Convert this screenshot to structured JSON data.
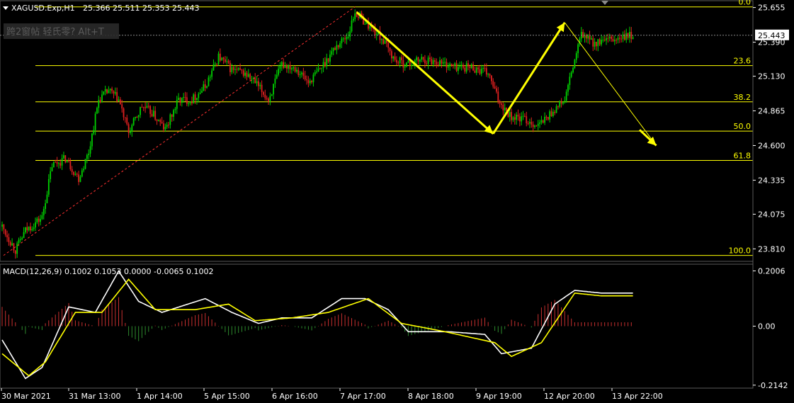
{
  "header": {
    "symbol": "XAGUSD.Exp,H1",
    "ohlc": "25.366 25.511 25.353 25.443"
  },
  "overlay_hint": "跨2窗帖 轻氏零? Alt+T",
  "macd_header": "MACD(12,26,9) 0.1002 0.1053 0.0000 -0.0065 0.1002",
  "colors": {
    "background": "#000000",
    "bull": "#00d000",
    "bear": "#e02020",
    "fib": "#ffff00",
    "arrow": "#ffff00",
    "trend": "#ff3030",
    "macd_line": "#ffffff",
    "signal_line": "#ffff00",
    "hist_pos": "#c83030",
    "hist_neg": "#2e8b2e",
    "axis": "#ffffff"
  },
  "chart_data": [
    {
      "type": "candlestick",
      "ylim": [
        23.72,
        25.68
      ],
      "y_ticks": [
        "25.655",
        "25.390",
        "25.130",
        "24.865",
        "24.600",
        "24.335",
        "24.075",
        "23.810"
      ],
      "y_tick_values": [
        25.655,
        25.39,
        25.13,
        24.865,
        24.6,
        24.335,
        24.075,
        23.81
      ],
      "current_price": "25.443",
      "current_price_value": 25.443,
      "x_labels": [
        "30 Mar 2021",
        "31 Mar 13:00",
        "1 Apr 14:00",
        "5 Apr 15:00",
        "6 Apr 16:00",
        "7 Apr 17:00",
        "8 Apr 18:00",
        "9 Apr 19:00",
        "12 Apr 20:00",
        "13 Apr 22:00"
      ],
      "fibonacci": {
        "low": 23.76,
        "high": 25.66,
        "levels": [
          {
            "label": "0.0",
            "value": 25.66
          },
          {
            "label": "23.6",
            "value": 25.211
          },
          {
            "label": "38.2",
            "value": 24.934
          },
          {
            "label": "50.0",
            "value": 24.71
          },
          {
            "label": "61.8",
            "value": 24.486
          },
          {
            "label": "100.0",
            "value": 23.76
          }
        ]
      },
      "waypoints": [
        [
          0,
          23.98
        ],
        [
          8,
          23.8
        ],
        [
          14,
          23.95
        ],
        [
          24,
          24.05
        ],
        [
          30,
          24.45
        ],
        [
          38,
          24.5
        ],
        [
          46,
          24.35
        ],
        [
          52,
          24.55
        ],
        [
          58,
          24.95
        ],
        [
          64,
          25.02
        ],
        [
          70,
          24.95
        ],
        [
          76,
          24.7
        ],
        [
          84,
          24.9
        ],
        [
          90,
          24.85
        ],
        [
          98,
          24.72
        ],
        [
          106,
          24.95
        ],
        [
          114,
          24.95
        ],
        [
          122,
          25.05
        ],
        [
          130,
          25.28
        ],
        [
          138,
          25.18
        ],
        [
          146,
          25.15
        ],
        [
          152,
          25.08
        ],
        [
          160,
          24.95
        ],
        [
          168,
          25.22
        ],
        [
          176,
          25.2
        ],
        [
          184,
          25.08
        ],
        [
          192,
          25.2
        ],
        [
          200,
          25.35
        ],
        [
          208,
          25.45
        ],
        [
          212,
          25.62
        ],
        [
          220,
          25.52
        ],
        [
          228,
          25.42
        ],
        [
          236,
          25.25
        ],
        [
          244,
          25.22
        ],
        [
          252,
          25.26
        ],
        [
          262,
          25.24
        ],
        [
          272,
          25.2
        ],
        [
          282,
          25.2
        ],
        [
          292,
          25.15
        ],
        [
          298,
          24.95
        ],
        [
          306,
          24.82
        ],
        [
          314,
          24.8
        ],
        [
          322,
          24.75
        ],
        [
          330,
          24.85
        ],
        [
          338,
          24.95
        ],
        [
          344,
          25.25
        ],
        [
          348,
          25.45
        ],
        [
          356,
          25.38
        ],
        [
          364,
          25.4
        ],
        [
          372,
          25.42
        ],
        [
          378,
          25.44
        ]
      ],
      "annotations": {
        "trend_line": [
          [
            23.76,
            0
          ],
          [
            25.66,
            212
          ]
        ],
        "arrow_1": [
          [
            25.62,
            213
          ],
          [
            24.69,
            295
          ]
        ],
        "arrow_2": [
          [
            24.69,
            295
          ],
          [
            25.54,
            338
          ]
        ],
        "arrow_3": [
          [
            25.54,
            338
          ],
          [
            24.6,
            393
          ]
        ]
      }
    },
    {
      "type": "macd",
      "params": "12,26,9",
      "ylim": [
        -0.225,
        0.225
      ],
      "y_ticks": [
        "0.2006",
        "0.00",
        "-0.2142"
      ],
      "y_tick_values": [
        0.2006,
        0.0,
        -0.2142
      ],
      "macd_waypoints": [
        [
          0,
          -0.05
        ],
        [
          14,
          -0.19
        ],
        [
          24,
          -0.15
        ],
        [
          40,
          0.07
        ],
        [
          56,
          0.05
        ],
        [
          70,
          0.2
        ],
        [
          82,
          0.09
        ],
        [
          96,
          0.05
        ],
        [
          122,
          0.1
        ],
        [
          138,
          0.05
        ],
        [
          154,
          0.01
        ],
        [
          168,
          0.03
        ],
        [
          186,
          0.03
        ],
        [
          204,
          0.1
        ],
        [
          218,
          0.1
        ],
        [
          232,
          0.06
        ],
        [
          244,
          -0.02
        ],
        [
          268,
          -0.02
        ],
        [
          290,
          -0.03
        ],
        [
          300,
          -0.1
        ],
        [
          318,
          -0.08
        ],
        [
          332,
          0.08
        ],
        [
          344,
          0.13
        ],
        [
          360,
          0.12
        ]
      ],
      "signal_waypoints": [
        [
          0,
          -0.1
        ],
        [
          16,
          -0.18
        ],
        [
          26,
          -0.13
        ],
        [
          44,
          0.05
        ],
        [
          60,
          0.05
        ],
        [
          76,
          0.17
        ],
        [
          92,
          0.06
        ],
        [
          116,
          0.06
        ],
        [
          136,
          0.08
        ],
        [
          152,
          0.02
        ],
        [
          174,
          0.03
        ],
        [
          196,
          0.05
        ],
        [
          220,
          0.1
        ],
        [
          240,
          0.01
        ],
        [
          266,
          -0.02
        ],
        [
          296,
          -0.06
        ],
        [
          306,
          -0.11
        ],
        [
          324,
          -0.06
        ],
        [
          344,
          0.12
        ],
        [
          360,
          0.11
        ]
      ]
    }
  ]
}
